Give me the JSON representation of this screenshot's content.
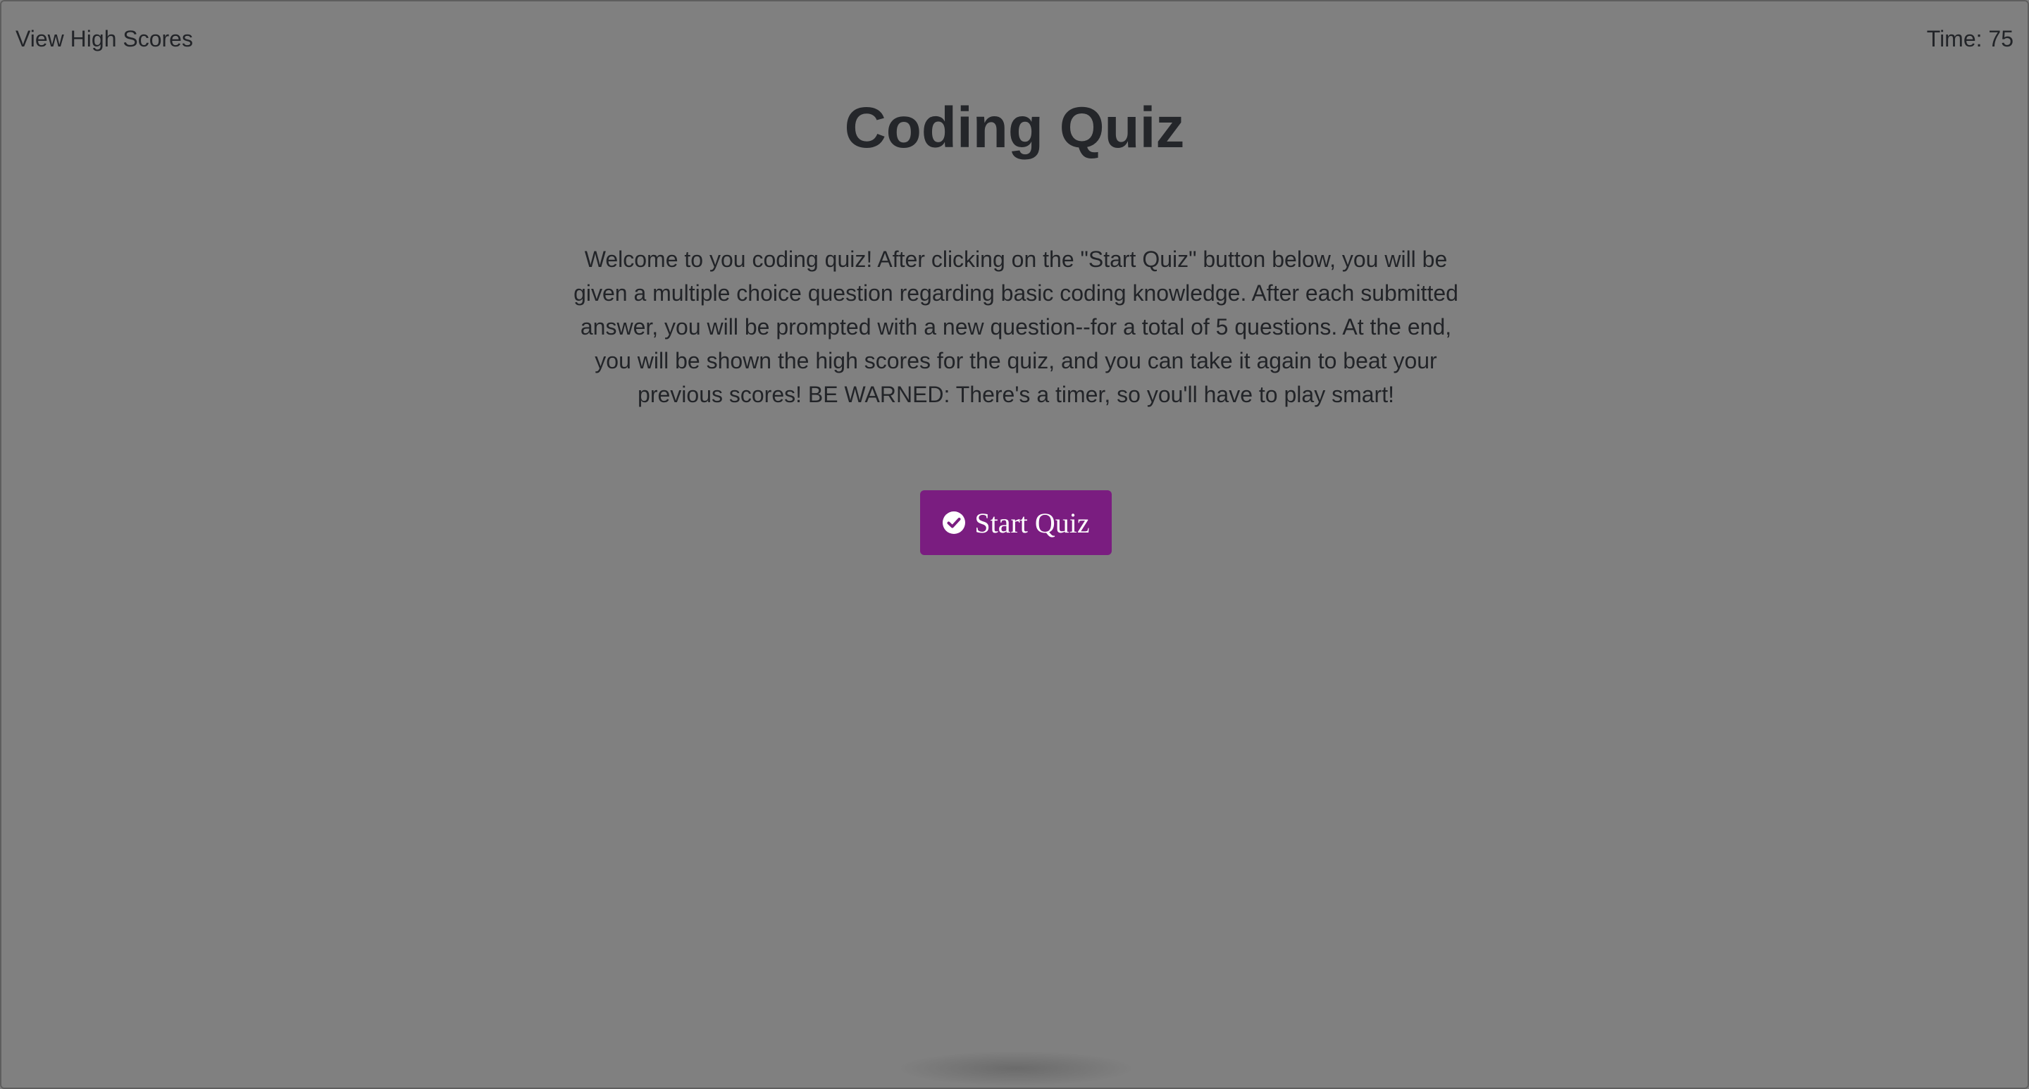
{
  "header": {
    "high_scores_link": "View High Scores",
    "timer_text": "Time: 75"
  },
  "main": {
    "title": "Coding Quiz",
    "intro": "Welcome to you coding quiz! After clicking on the \"Start Quiz\" button below, you will be given a multiple choice question regarding basic coding knowledge. After each submitted answer, you will be prompted with a new question--for a total of 5 questions. At the end, you will be shown the high scores for the quiz, and you can take it again to beat your previous scores! BE WARNED: There's a timer, so you'll have to play smart!",
    "start_button_label": "Start Quiz",
    "start_button_icon": "check-circle-icon"
  },
  "colors": {
    "background": "#808080",
    "button": "#7a1d80",
    "text": "#222428"
  }
}
